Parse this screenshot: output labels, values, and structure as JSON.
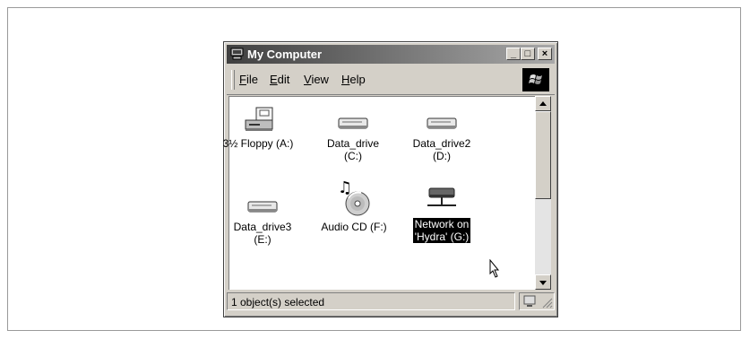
{
  "window": {
    "title": "My Computer"
  },
  "menu": {
    "file": "F",
    "file_rest": "ile",
    "edit": "E",
    "edit_rest": "dit",
    "view": "V",
    "view_rest": "iew",
    "help": "H",
    "help_rest": "elp"
  },
  "items": [
    {
      "label": "3½ Floppy (A:)",
      "icon": "floppy-drive-icon"
    },
    {
      "label": "Data_drive",
      "label2": "(C:)",
      "icon": "hard-drive-icon"
    },
    {
      "label": "Data_drive2",
      "label2": "(D:)",
      "icon": "hard-drive-icon"
    },
    {
      "label": "Data_drive3",
      "label2": "(E:)",
      "icon": "hard-drive-icon"
    },
    {
      "label": "Audio CD (F:)",
      "icon": "cd-drive-icon"
    },
    {
      "label": "Network on",
      "label2": "'Hydra' (G:)",
      "icon": "network-drive-icon",
      "selected": true
    }
  ],
  "status": {
    "text": "1 object(s) selected"
  }
}
